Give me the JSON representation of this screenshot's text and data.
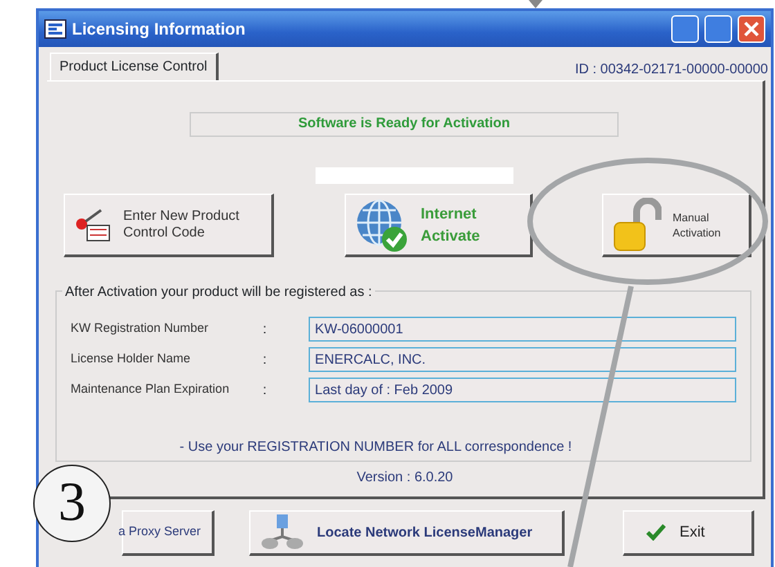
{
  "window": {
    "title": "Licensing Information"
  },
  "tabs": [
    {
      "label": "Product License Control",
      "selected": true
    }
  ],
  "id_text": "ID : 00342-02171-00000-00000",
  "status": "Software is Ready for Activation",
  "action_buttons": [
    {
      "kind": "keys",
      "lines": [
        "Enter New Product",
        "Control Code"
      ]
    },
    {
      "kind": "globe",
      "lines": [
        "Internet",
        "Activate"
      ]
    },
    {
      "kind": "lock",
      "lines": [
        "Manual",
        "Activation"
      ]
    }
  ],
  "registration": {
    "title": "After Activation your product will be registered as :",
    "fields": [
      {
        "label": "KW Registration Number",
        "separator": ":",
        "value": "KW-06000001"
      },
      {
        "label": "License Holder Name",
        "separator": ":",
        "value": "ENERCALC, INC."
      },
      {
        "label": "Maintenance Plan Expiration",
        "separator": ":",
        "value": "Last day of : Feb 2009"
      }
    ]
  },
  "note": "-   Use your REGISTRATION NUMBER for ALL correspondence !",
  "version": "Version : 6.0.20",
  "bottom_buttons": [
    {
      "kind": "proxy",
      "label": "a Proxy Server"
    },
    {
      "kind": "network",
      "label": "Locate Network LicenseManager"
    },
    {
      "kind": "exit",
      "label": "Exit"
    }
  ],
  "callout": "3"
}
